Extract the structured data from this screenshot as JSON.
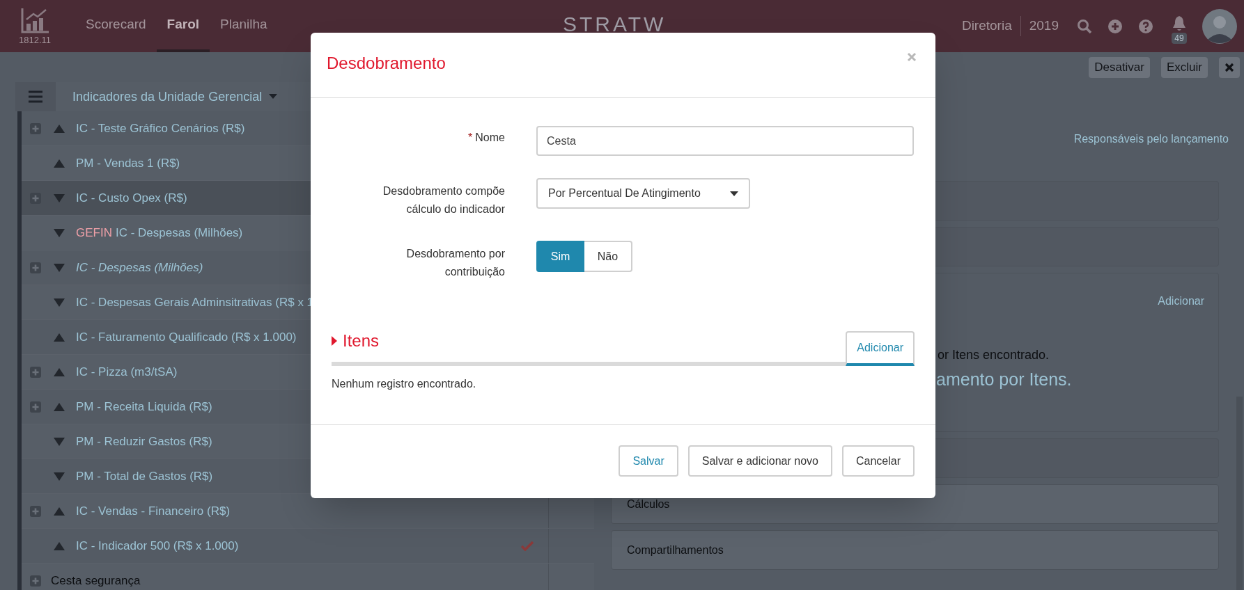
{
  "header": {
    "version": "1812.11",
    "nav": [
      {
        "label": "Scorecard",
        "selected": false
      },
      {
        "label": "Farol",
        "selected": true
      },
      {
        "label": "Planilha",
        "selected": false
      }
    ],
    "logo": "STRATW",
    "unit": "Diretoria",
    "year": "2019",
    "notifications": "49"
  },
  "toolbar": {
    "buttons": [
      "Desativar",
      "Excluir"
    ]
  },
  "list": {
    "title": "Indicadores da Unidade Gerencial",
    "rows": [
      {
        "label": "IC - Teste Gráfico Cenários (R$)",
        "rising": true,
        "expandable": true,
        "italic": false,
        "highlighted": false,
        "checked": false
      },
      {
        "label": "PM - Vendas 1 (R$)",
        "rising": true,
        "expandable": false,
        "italic": false,
        "highlighted": false,
        "checked": false
      },
      {
        "label": "IC - Custo Opex (R$)",
        "rising": false,
        "expandable": true,
        "italic": false,
        "highlighted": true,
        "checked": false
      },
      {
        "prefix": "GEFIN",
        "label": "IC - Despesas (Milhões)",
        "rising": false,
        "expandable": false,
        "italic": false,
        "highlighted": false,
        "checked": false
      },
      {
        "label": "IC - Despesas (Milhões)",
        "rising": false,
        "expandable": true,
        "italic": true,
        "highlighted": false,
        "checked": false
      },
      {
        "label": "IC - Despesas Gerais Adminsitrativas (R$ x 1",
        "rising": false,
        "expandable": false,
        "italic": false,
        "highlighted": false,
        "checked": false
      },
      {
        "label": "IC - Faturamento Qualificado (R$ x 1.000)",
        "rising": true,
        "expandable": false,
        "italic": false,
        "highlighted": false,
        "checked": false
      },
      {
        "label": "IC - Pizza (m3/tSA)",
        "rising": true,
        "expandable": true,
        "italic": false,
        "highlighted": false,
        "checked": false
      },
      {
        "label": "PM - Receita Liquida (R$)",
        "rising": true,
        "expandable": true,
        "italic": false,
        "highlighted": false,
        "checked": false
      },
      {
        "label": "PM - Reduzir Gastos (R$)",
        "rising": false,
        "expandable": false,
        "italic": false,
        "highlighted": false,
        "checked": false
      },
      {
        "label": "PM - Total de Gastos (R$)",
        "rising": false,
        "expandable": false,
        "italic": false,
        "highlighted": false,
        "checked": false
      },
      {
        "label": "IC - Vendas - Financeiro (R$)",
        "rising": true,
        "expandable": true,
        "italic": false,
        "highlighted": false,
        "checked": false
      },
      {
        "label": "IC - Indicador 500 (R$ x 1.000)",
        "rising": true,
        "expandable": false,
        "italic": false,
        "highlighted": false,
        "checked": true
      },
      {
        "label": "Cesta segurança",
        "expandable": true,
        "italic": false,
        "highlighted": false,
        "checked": false
      }
    ]
  },
  "details": {
    "link": "Responsáveis pelo lançamento",
    "add_link": "Adicionar",
    "empty_text": "or Itens encontrado.",
    "empty_action": "amento por Itens.",
    "sections": [
      "Cálculos",
      "Compartilhamentos"
    ]
  },
  "modal": {
    "title": "Desdobramento",
    "fields": [
      {
        "kind": "text",
        "label": "Nome",
        "required_mark": "*",
        "value": "Cesta"
      },
      {
        "kind": "select",
        "label": "Desdobramento compõe cálculo do indicador",
        "value": "Por Percentual De Atingimento"
      },
      {
        "kind": "toggle",
        "label": "Desdobramento por contribuição",
        "options": [
          {
            "label": "Sim",
            "selected": true
          },
          {
            "label": "Não",
            "selected": false
          }
        ]
      }
    ],
    "section": {
      "title": "Itens",
      "tab": "Adicionar",
      "empty": "Nenhum registro encontrado."
    },
    "buttons": [
      {
        "label": "Salvar",
        "primary": true
      },
      {
        "label": "Salvar e adicionar novo",
        "primary": false
      },
      {
        "label": "Cancelar",
        "primary": false
      }
    ]
  }
}
